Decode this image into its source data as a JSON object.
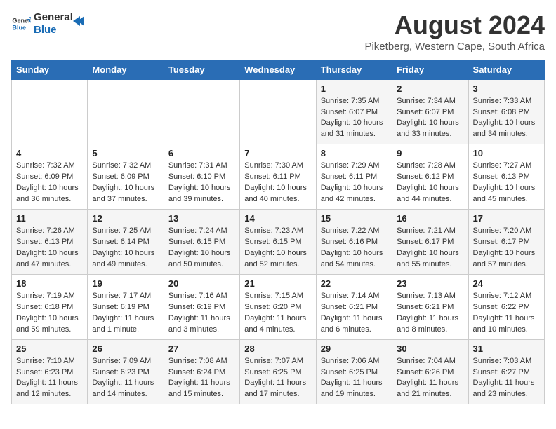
{
  "header": {
    "logo_general": "General",
    "logo_blue": "Blue",
    "month_year": "August 2024",
    "location": "Piketberg, Western Cape, South Africa"
  },
  "days_of_week": [
    "Sunday",
    "Monday",
    "Tuesday",
    "Wednesday",
    "Thursday",
    "Friday",
    "Saturday"
  ],
  "weeks": [
    [
      {
        "day": "",
        "detail": ""
      },
      {
        "day": "",
        "detail": ""
      },
      {
        "day": "",
        "detail": ""
      },
      {
        "day": "",
        "detail": ""
      },
      {
        "day": "1",
        "detail": "Sunrise: 7:35 AM\nSunset: 6:07 PM\nDaylight: 10 hours\nand 31 minutes."
      },
      {
        "day": "2",
        "detail": "Sunrise: 7:34 AM\nSunset: 6:07 PM\nDaylight: 10 hours\nand 33 minutes."
      },
      {
        "day": "3",
        "detail": "Sunrise: 7:33 AM\nSunset: 6:08 PM\nDaylight: 10 hours\nand 34 minutes."
      }
    ],
    [
      {
        "day": "4",
        "detail": "Sunrise: 7:32 AM\nSunset: 6:09 PM\nDaylight: 10 hours\nand 36 minutes."
      },
      {
        "day": "5",
        "detail": "Sunrise: 7:32 AM\nSunset: 6:09 PM\nDaylight: 10 hours\nand 37 minutes."
      },
      {
        "day": "6",
        "detail": "Sunrise: 7:31 AM\nSunset: 6:10 PM\nDaylight: 10 hours\nand 39 minutes."
      },
      {
        "day": "7",
        "detail": "Sunrise: 7:30 AM\nSunset: 6:11 PM\nDaylight: 10 hours\nand 40 minutes."
      },
      {
        "day": "8",
        "detail": "Sunrise: 7:29 AM\nSunset: 6:11 PM\nDaylight: 10 hours\nand 42 minutes."
      },
      {
        "day": "9",
        "detail": "Sunrise: 7:28 AM\nSunset: 6:12 PM\nDaylight: 10 hours\nand 44 minutes."
      },
      {
        "day": "10",
        "detail": "Sunrise: 7:27 AM\nSunset: 6:13 PM\nDaylight: 10 hours\nand 45 minutes."
      }
    ],
    [
      {
        "day": "11",
        "detail": "Sunrise: 7:26 AM\nSunset: 6:13 PM\nDaylight: 10 hours\nand 47 minutes."
      },
      {
        "day": "12",
        "detail": "Sunrise: 7:25 AM\nSunset: 6:14 PM\nDaylight: 10 hours\nand 49 minutes."
      },
      {
        "day": "13",
        "detail": "Sunrise: 7:24 AM\nSunset: 6:15 PM\nDaylight: 10 hours\nand 50 minutes."
      },
      {
        "day": "14",
        "detail": "Sunrise: 7:23 AM\nSunset: 6:15 PM\nDaylight: 10 hours\nand 52 minutes."
      },
      {
        "day": "15",
        "detail": "Sunrise: 7:22 AM\nSunset: 6:16 PM\nDaylight: 10 hours\nand 54 minutes."
      },
      {
        "day": "16",
        "detail": "Sunrise: 7:21 AM\nSunset: 6:17 PM\nDaylight: 10 hours\nand 55 minutes."
      },
      {
        "day": "17",
        "detail": "Sunrise: 7:20 AM\nSunset: 6:17 PM\nDaylight: 10 hours\nand 57 minutes."
      }
    ],
    [
      {
        "day": "18",
        "detail": "Sunrise: 7:19 AM\nSunset: 6:18 PM\nDaylight: 10 hours\nand 59 minutes."
      },
      {
        "day": "19",
        "detail": "Sunrise: 7:17 AM\nSunset: 6:19 PM\nDaylight: 11 hours\nand 1 minute."
      },
      {
        "day": "20",
        "detail": "Sunrise: 7:16 AM\nSunset: 6:19 PM\nDaylight: 11 hours\nand 3 minutes."
      },
      {
        "day": "21",
        "detail": "Sunrise: 7:15 AM\nSunset: 6:20 PM\nDaylight: 11 hours\nand 4 minutes."
      },
      {
        "day": "22",
        "detail": "Sunrise: 7:14 AM\nSunset: 6:21 PM\nDaylight: 11 hours\nand 6 minutes."
      },
      {
        "day": "23",
        "detail": "Sunrise: 7:13 AM\nSunset: 6:21 PM\nDaylight: 11 hours\nand 8 minutes."
      },
      {
        "day": "24",
        "detail": "Sunrise: 7:12 AM\nSunset: 6:22 PM\nDaylight: 11 hours\nand 10 minutes."
      }
    ],
    [
      {
        "day": "25",
        "detail": "Sunrise: 7:10 AM\nSunset: 6:23 PM\nDaylight: 11 hours\nand 12 minutes."
      },
      {
        "day": "26",
        "detail": "Sunrise: 7:09 AM\nSunset: 6:23 PM\nDaylight: 11 hours\nand 14 minutes."
      },
      {
        "day": "27",
        "detail": "Sunrise: 7:08 AM\nSunset: 6:24 PM\nDaylight: 11 hours\nand 15 minutes."
      },
      {
        "day": "28",
        "detail": "Sunrise: 7:07 AM\nSunset: 6:25 PM\nDaylight: 11 hours\nand 17 minutes."
      },
      {
        "day": "29",
        "detail": "Sunrise: 7:06 AM\nSunset: 6:25 PM\nDaylight: 11 hours\nand 19 minutes."
      },
      {
        "day": "30",
        "detail": "Sunrise: 7:04 AM\nSunset: 6:26 PM\nDaylight: 11 hours\nand 21 minutes."
      },
      {
        "day": "31",
        "detail": "Sunrise: 7:03 AM\nSunset: 6:27 PM\nDaylight: 11 hours\nand 23 minutes."
      }
    ]
  ]
}
